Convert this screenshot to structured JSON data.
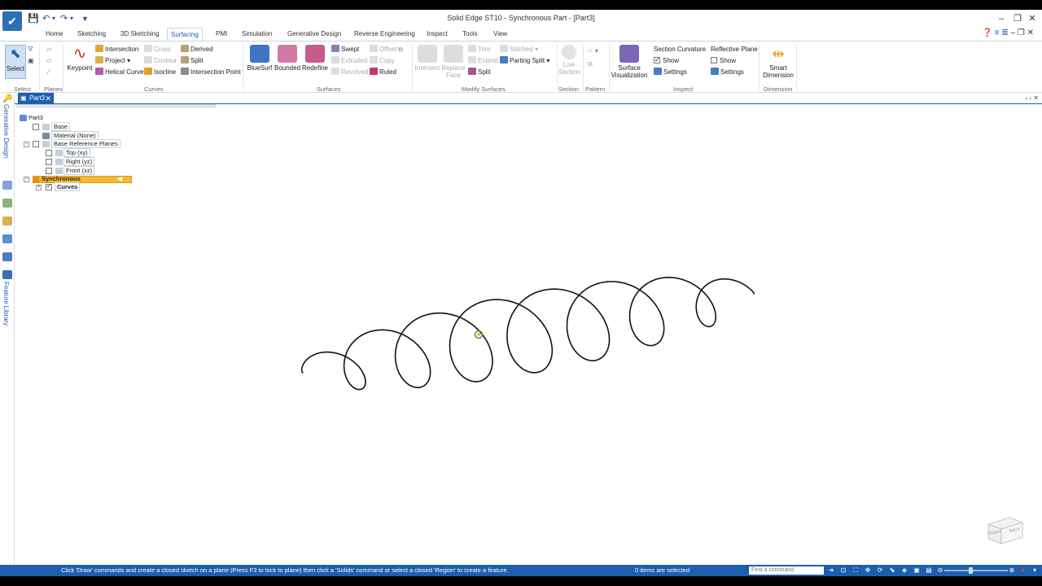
{
  "window": {
    "title": "Solid Edge ST10 - Synchronous Part - [Part3]"
  },
  "ribbon_tabs": [
    "Home",
    "Sketching",
    "3D Sketching",
    "Surfacing",
    "PMI",
    "Simulation",
    "Generative Design",
    "Reverse Engineering",
    "Inspect",
    "Tools",
    "View"
  ],
  "active_tab": "Surfacing",
  "ribbon": {
    "select_group": {
      "select": "Select",
      "label": "Select"
    },
    "planes_group": {
      "label": "Planes"
    },
    "curves_group": {
      "keypoint": "Keypoint",
      "intersection": "Intersection",
      "project": "Project",
      "helical_curve": "Helical Curve",
      "cross": "Cross",
      "contour": "Contour",
      "isocline": "Isocline",
      "derived": "Derived",
      "split": "Split",
      "intersection_point": "Intersection Point",
      "label": "Curves"
    },
    "surfaces_group": {
      "bluesurf": "BlueSurf",
      "bounded": "Bounded",
      "redefine": "Redefine",
      "swept": "Swept",
      "extruded": "Extruded",
      "revolved": "Revolved",
      "offset": "Offset",
      "copy": "Copy",
      "ruled": "Ruled",
      "label": "Surfaces"
    },
    "modify_group": {
      "intersect": "Intersect",
      "replace_face": "Replace Face",
      "trim": "Trim",
      "extend": "Extend",
      "split": "Split",
      "stitched": "Stitched",
      "parting_split": "Parting Split",
      "label": "Modify Surfaces"
    },
    "section_group": {
      "live_section": "Live Section",
      "label": "Section"
    },
    "pattern_group": {
      "label": "Pattern"
    },
    "inspect_group": {
      "surface_visualization": "Surface Visualization",
      "section_curvature": "Section Curvature",
      "show": "Show",
      "settings": "Settings",
      "reflective_plane": "Reflective Plane",
      "show2": "Show",
      "settings2": "Settings",
      "label": "Inspect"
    },
    "dimension_group": {
      "smart_dimension": "Smart Dimension",
      "label": "Dimension"
    }
  },
  "document_tab": "Part3",
  "left_strip": {
    "generative_design": "Generative Design",
    "feature_library": "Feature Library"
  },
  "tree": {
    "root": "Part3",
    "base": "Base",
    "material": "Material (None)",
    "base_reference_planes": "Base Reference Planes",
    "top": "Top (xy)",
    "right": "Right (yz)",
    "front": "Front (xz)",
    "synchronous": "Synchronous",
    "curves": "Curves"
  },
  "viewcube": {
    "right": "RIGHT",
    "back": "BACK"
  },
  "status": {
    "prompt": "Click 'Draw' commands and create a closed sketch on a plane (Press F3 to lock to plane) then click a 'Solids' command or select a closed 'Region' to create a feature.",
    "selection": "0 items are selected",
    "find_placeholder": "Find a command"
  },
  "colors": {
    "accent": "#1d5fae",
    "synchronous_highlight": "#f4b934",
    "curve": "#111111"
  }
}
